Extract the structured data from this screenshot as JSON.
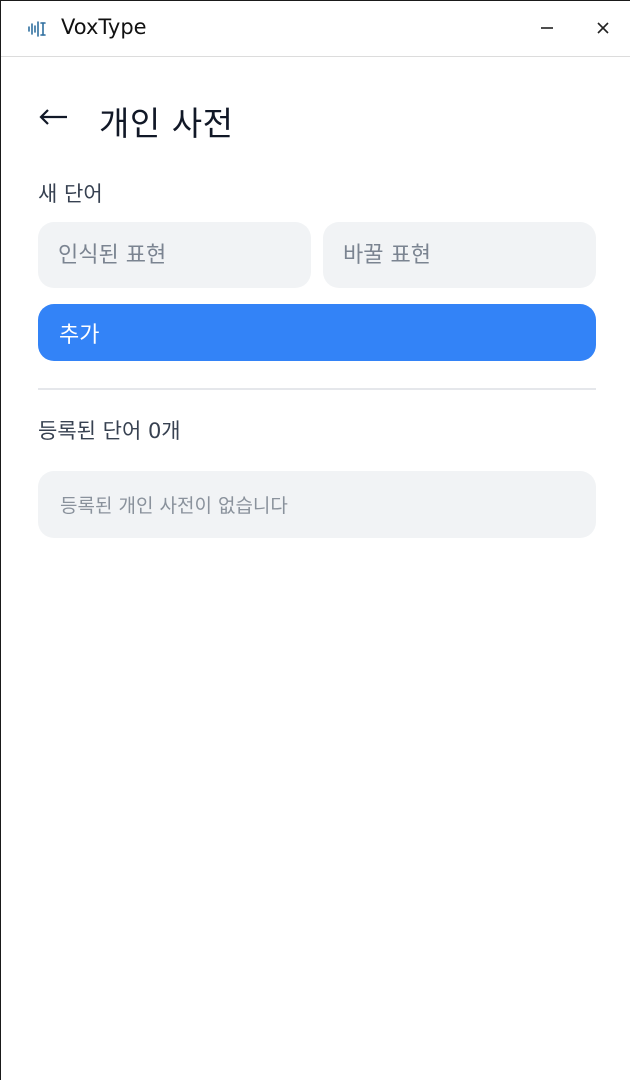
{
  "window": {
    "title": "VoxType",
    "app_icon": "waveform-icon",
    "minimize_icon": "minimize-icon",
    "close_icon": "close-icon"
  },
  "header": {
    "back_icon": "arrow-left-icon",
    "title": "개인 사전"
  },
  "new_word": {
    "label": "새 단어",
    "recognized_placeholder": "인식된 표현",
    "recognized_value": "",
    "replacement_placeholder": "바꿀 표현",
    "replacement_value": "",
    "add_label": "추가"
  },
  "registered": {
    "count_label": "등록된 단어 0개",
    "empty_message": "등록된 개인 사전이 없습니다"
  },
  "colors": {
    "accent": "#3383f7",
    "input_bg": "#f1f3f5",
    "app_icon": "#2f6f9f"
  }
}
